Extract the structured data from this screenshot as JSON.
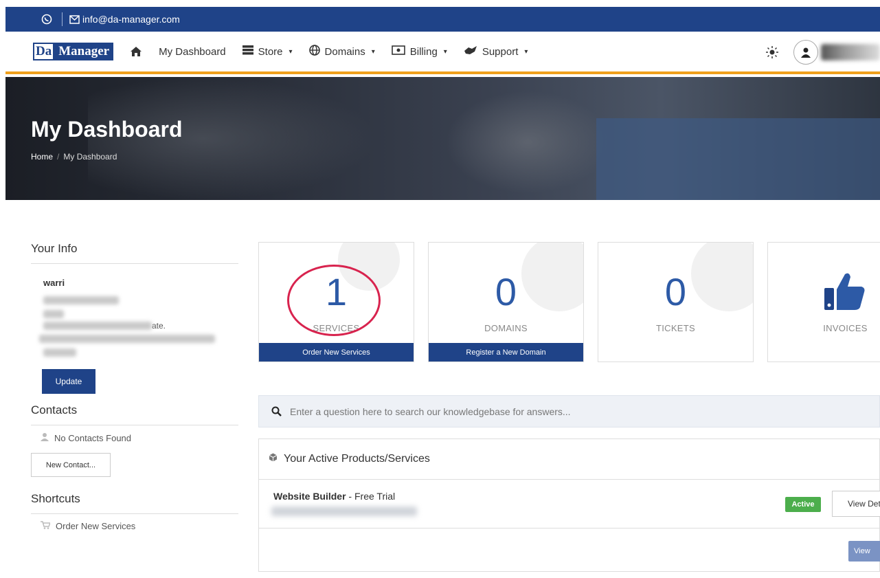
{
  "topbar": {
    "email": "info@da-manager.com"
  },
  "navbar": {
    "logo_da": "Da",
    "logo_manager": "Manager",
    "items": [
      {
        "label": "My Dashboard",
        "icon": ""
      },
      {
        "label": "Store",
        "icon": "store-icon"
      },
      {
        "label": "Domains",
        "icon": "globe-icon"
      },
      {
        "label": "Billing",
        "icon": "billing-icon"
      },
      {
        "label": "Support",
        "icon": "support-icon"
      }
    ]
  },
  "hero": {
    "title": "My Dashboard",
    "breadcrumb_home": "Home",
    "breadcrumb_current": "My Dashboard"
  },
  "sidebar": {
    "your_info_heading": "Your Info",
    "name": "warri",
    "state_fragment": "ate.",
    "update_label": "Update",
    "contacts_heading": "Contacts",
    "no_contacts": "No Contacts Found",
    "new_contact": "New Contact...",
    "shortcuts_heading": "Shortcuts",
    "order_new_services": "Order New Services"
  },
  "tiles": [
    {
      "count": "1",
      "label": "SERVICES",
      "action": "Order New Services"
    },
    {
      "count": "0",
      "label": "DOMAINS",
      "action": "Register a New Domain"
    },
    {
      "count": "0",
      "label": "TICKETS"
    },
    {
      "label": "INVOICES"
    }
  ],
  "search": {
    "placeholder": "Enter a question here to search our knowledgebase for answers..."
  },
  "products": {
    "heading": "Your Active Products/Services",
    "item_name": "Website Builder",
    "item_plan": " - Free Trial",
    "status": "Active",
    "view_details": "View Det",
    "view_all": "View"
  },
  "colors": {
    "brand": "#1f4388",
    "accent": "#f0a01c",
    "count": "#2d5aa6",
    "active": "#4cae4c",
    "highlight": "#d8234e"
  }
}
